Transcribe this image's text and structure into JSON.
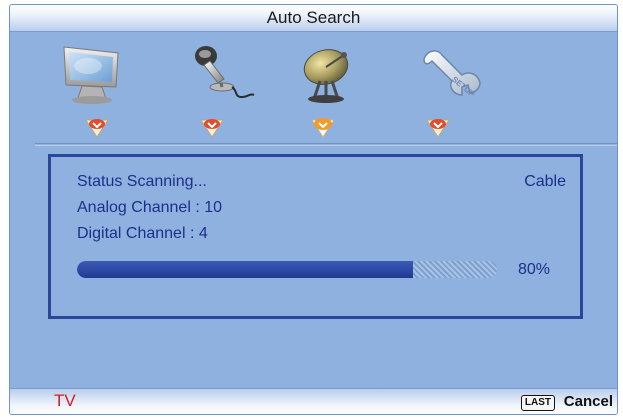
{
  "header": {
    "title": "Auto Search"
  },
  "menu": {
    "icons": [
      "picture-icon",
      "audio-icon",
      "channel-icon",
      "setup-icon"
    ],
    "selected_index": 2,
    "setup_icon_text": "SETUP"
  },
  "scan": {
    "status_text": "Status Scanning...",
    "source_type": "Cable",
    "analog_text": "Analog Channel : 10",
    "digital_text": "Digital Channel : 4",
    "progress_fraction": 0.8,
    "progress_text": "80%"
  },
  "footer": {
    "source_label": "TV",
    "last_key": "LAST",
    "cancel_label": "Cancel"
  },
  "colors": {
    "panel_bg": "#8fb1e0",
    "text_blue": "#1c2f8a",
    "progress_blue": "#2a48a2",
    "source_red": "#d21e1e"
  }
}
